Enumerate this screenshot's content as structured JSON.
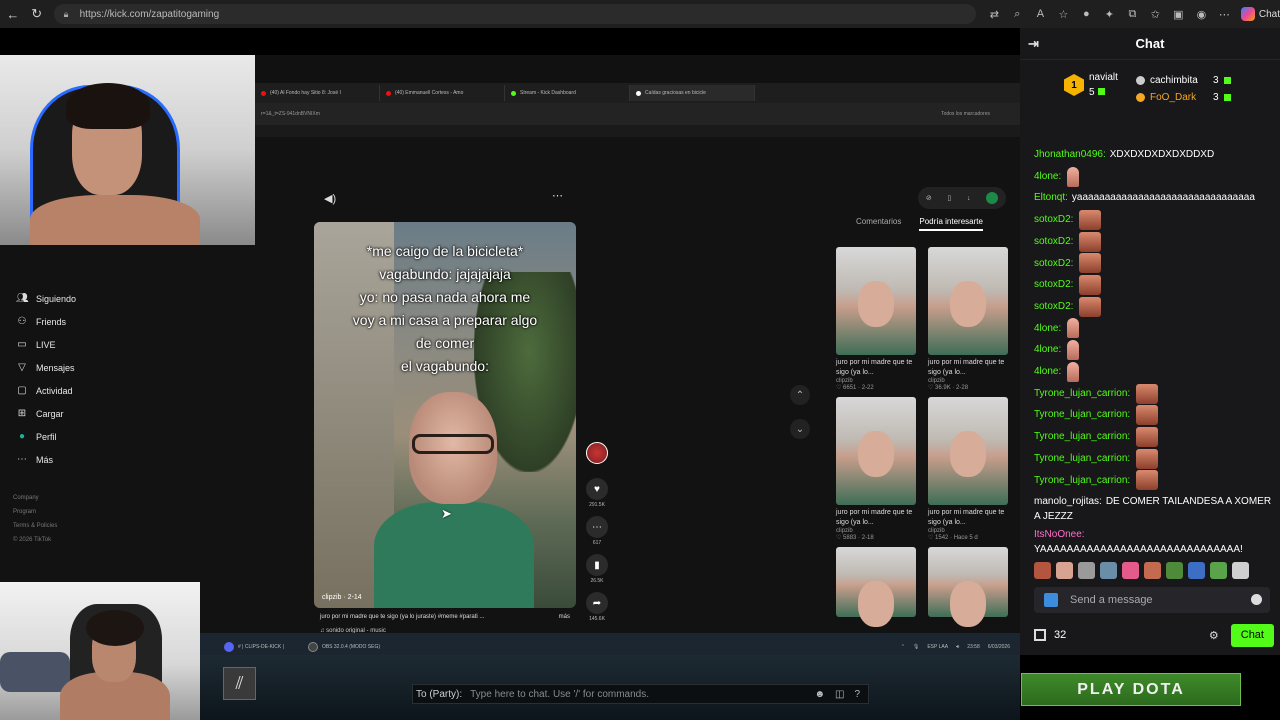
{
  "browser": {
    "url": "https://kick.com/zapatitogaming",
    "copilot_label": "Chat"
  },
  "inner": {
    "tabs": [
      "(40) Al Fondo hay Sitio 8: José I",
      "(40) Emmanuell Cortess - Amo",
      "Stream - Kick Dashboard",
      "Caídas graciosas en bicicle"
    ],
    "address": "r=1&_t=ZS-941dnBVNIXm",
    "bookmarks_label": "Todos los marcadores"
  },
  "tiktok": {
    "sidebar": [
      {
        "icon": "users-icon",
        "label": "Siguiendo"
      },
      {
        "icon": "friends-icon",
        "label": "Friends"
      },
      {
        "icon": "live-icon",
        "label": "LIVE"
      },
      {
        "icon": "messages-icon",
        "label": "Mensajes"
      },
      {
        "icon": "activity-icon",
        "label": "Actividad"
      },
      {
        "icon": "upload-icon",
        "label": "Cargar"
      },
      {
        "icon": "profile-icon",
        "label": "Perfil"
      },
      {
        "icon": "more-icon",
        "label": "Más"
      }
    ],
    "footer": [
      "Company",
      "Program",
      "Terms & Policies",
      "© 2026 TikTok"
    ],
    "video": {
      "caption_lines": [
        "*me caigo de la bicicleta*",
        "vagabundo: jajajajaja",
        "yo: no pasa nada ahora me",
        "voy a mi casa a preparar algo",
        "de comer",
        "el vagabundo:"
      ],
      "user": "clipzib · 2-14",
      "description": "juro por mi madre que te sigo (ya lo juraste) #meme #parati ...",
      "more": "más",
      "sound": "♫ sonido original - music",
      "progress": 0.18
    },
    "actions": [
      {
        "icon": "heart-icon",
        "count": "291.5K"
      },
      {
        "icon": "comment-icon",
        "count": "617"
      },
      {
        "icon": "bookmark-icon",
        "count": "26.5K"
      },
      {
        "icon": "share-icon",
        "count": "145.6K"
      }
    ],
    "right_tabs": [
      "Comentarios",
      "Podría interesarte"
    ],
    "thumbs": [
      {
        "title": "juro por mi madre que te sigo (ya lo...",
        "user": "clipzib",
        "meta": "♡ 6651 · 2-22"
      },
      {
        "title": "juro por mi madre que te sigo (ya lo...",
        "user": "clipzib",
        "meta": "♡ 36.9K · 2-28"
      },
      {
        "title": "juro por mi madre que te sigo (ya lo...",
        "user": "clipzib",
        "meta": "♡ 5883 · 2-18"
      },
      {
        "title": "juro por mi madre que te sigo (ya lo...",
        "user": "clipzib",
        "meta": "♡ 1542 · Hace 5 d"
      },
      {
        "title": "",
        "user": "",
        "meta": ""
      },
      {
        "title": "",
        "user": "",
        "meta": ""
      }
    ]
  },
  "taskbar": {
    "items": [
      "# | CLIPS-DE-KICK |",
      "OBS 32.0.4 (MODO SEG)"
    ],
    "lang": "ESP LAA",
    "time": "23:58",
    "date": "6/03/2026"
  },
  "dota": {
    "party_label": "To (Party):",
    "party_placeholder": "Type here to chat. Use '/' for commands.",
    "play_button": "PLAY DOTA"
  },
  "chat": {
    "title": "Chat",
    "top_gifter": {
      "rank": "1",
      "name": "navialt",
      "count": "5"
    },
    "gifters": [
      {
        "name": "cachimbita",
        "count": "3",
        "color": "#ffffff"
      },
      {
        "name": "FoO_Dark",
        "count": "3",
        "color": "#f5a623"
      }
    ],
    "messages": [
      {
        "user": "Jhonathan0496:",
        "color": "#53fc18",
        "text": "XDXDXDXDXDXDDXD",
        "emote": ""
      },
      {
        "user": "4lone:",
        "color": "#53fc18",
        "text": "",
        "emote": "small"
      },
      {
        "user": "Eltonqt:",
        "color": "#53fc18",
        "text": "yaaaaaaaaaaaaaaaaaaaaaaaaaaaaaaaa",
        "emote": ""
      },
      {
        "user": "sotoxD2:",
        "color": "#53fc18",
        "text": "",
        "emote": "big"
      },
      {
        "user": "sotoxD2:",
        "color": "#53fc18",
        "text": "",
        "emote": "big"
      },
      {
        "user": "sotoxD2:",
        "color": "#53fc18",
        "text": "",
        "emote": "big"
      },
      {
        "user": "sotoxD2:",
        "color": "#53fc18",
        "text": "",
        "emote": "big"
      },
      {
        "user": "sotoxD2:",
        "color": "#53fc18",
        "text": "",
        "emote": "big"
      },
      {
        "user": "4lone:",
        "color": "#53fc18",
        "text": "",
        "emote": "small"
      },
      {
        "user": "4lone:",
        "color": "#53fc18",
        "text": "",
        "emote": "small"
      },
      {
        "user": "4lone:",
        "color": "#53fc18",
        "text": "",
        "emote": "small"
      },
      {
        "user": "Tyrone_lujan_carrion:",
        "color": "#53fc18",
        "text": "",
        "emote": "big"
      },
      {
        "user": "Tyrone_lujan_carrion:",
        "color": "#53fc18",
        "text": "",
        "emote": "big"
      },
      {
        "user": "Tyrone_lujan_carrion:",
        "color": "#53fc18",
        "text": "",
        "emote": "big"
      },
      {
        "user": "Tyrone_lujan_carrion:",
        "color": "#53fc18",
        "text": "",
        "emote": "big"
      },
      {
        "user": "Tyrone_lujan_carrion:",
        "color": "#53fc18",
        "text": "",
        "emote": "big"
      }
    ],
    "wrap_messages": [
      {
        "user": "manolo_rojitas:",
        "color": "#ffffff",
        "text": "DE COMER TAILANDESA A XOMER A JEZZZ"
      },
      {
        "user": "ItsNoOnee:",
        "color": "#ff6ec7",
        "text": "YAAAAAAAAAAAAAAAAAAAAAAAAAAAAAA!"
      }
    ],
    "input_placeholder": "Send a message",
    "points": "32",
    "chat_button": "Chat",
    "accent": "#53fc18"
  }
}
